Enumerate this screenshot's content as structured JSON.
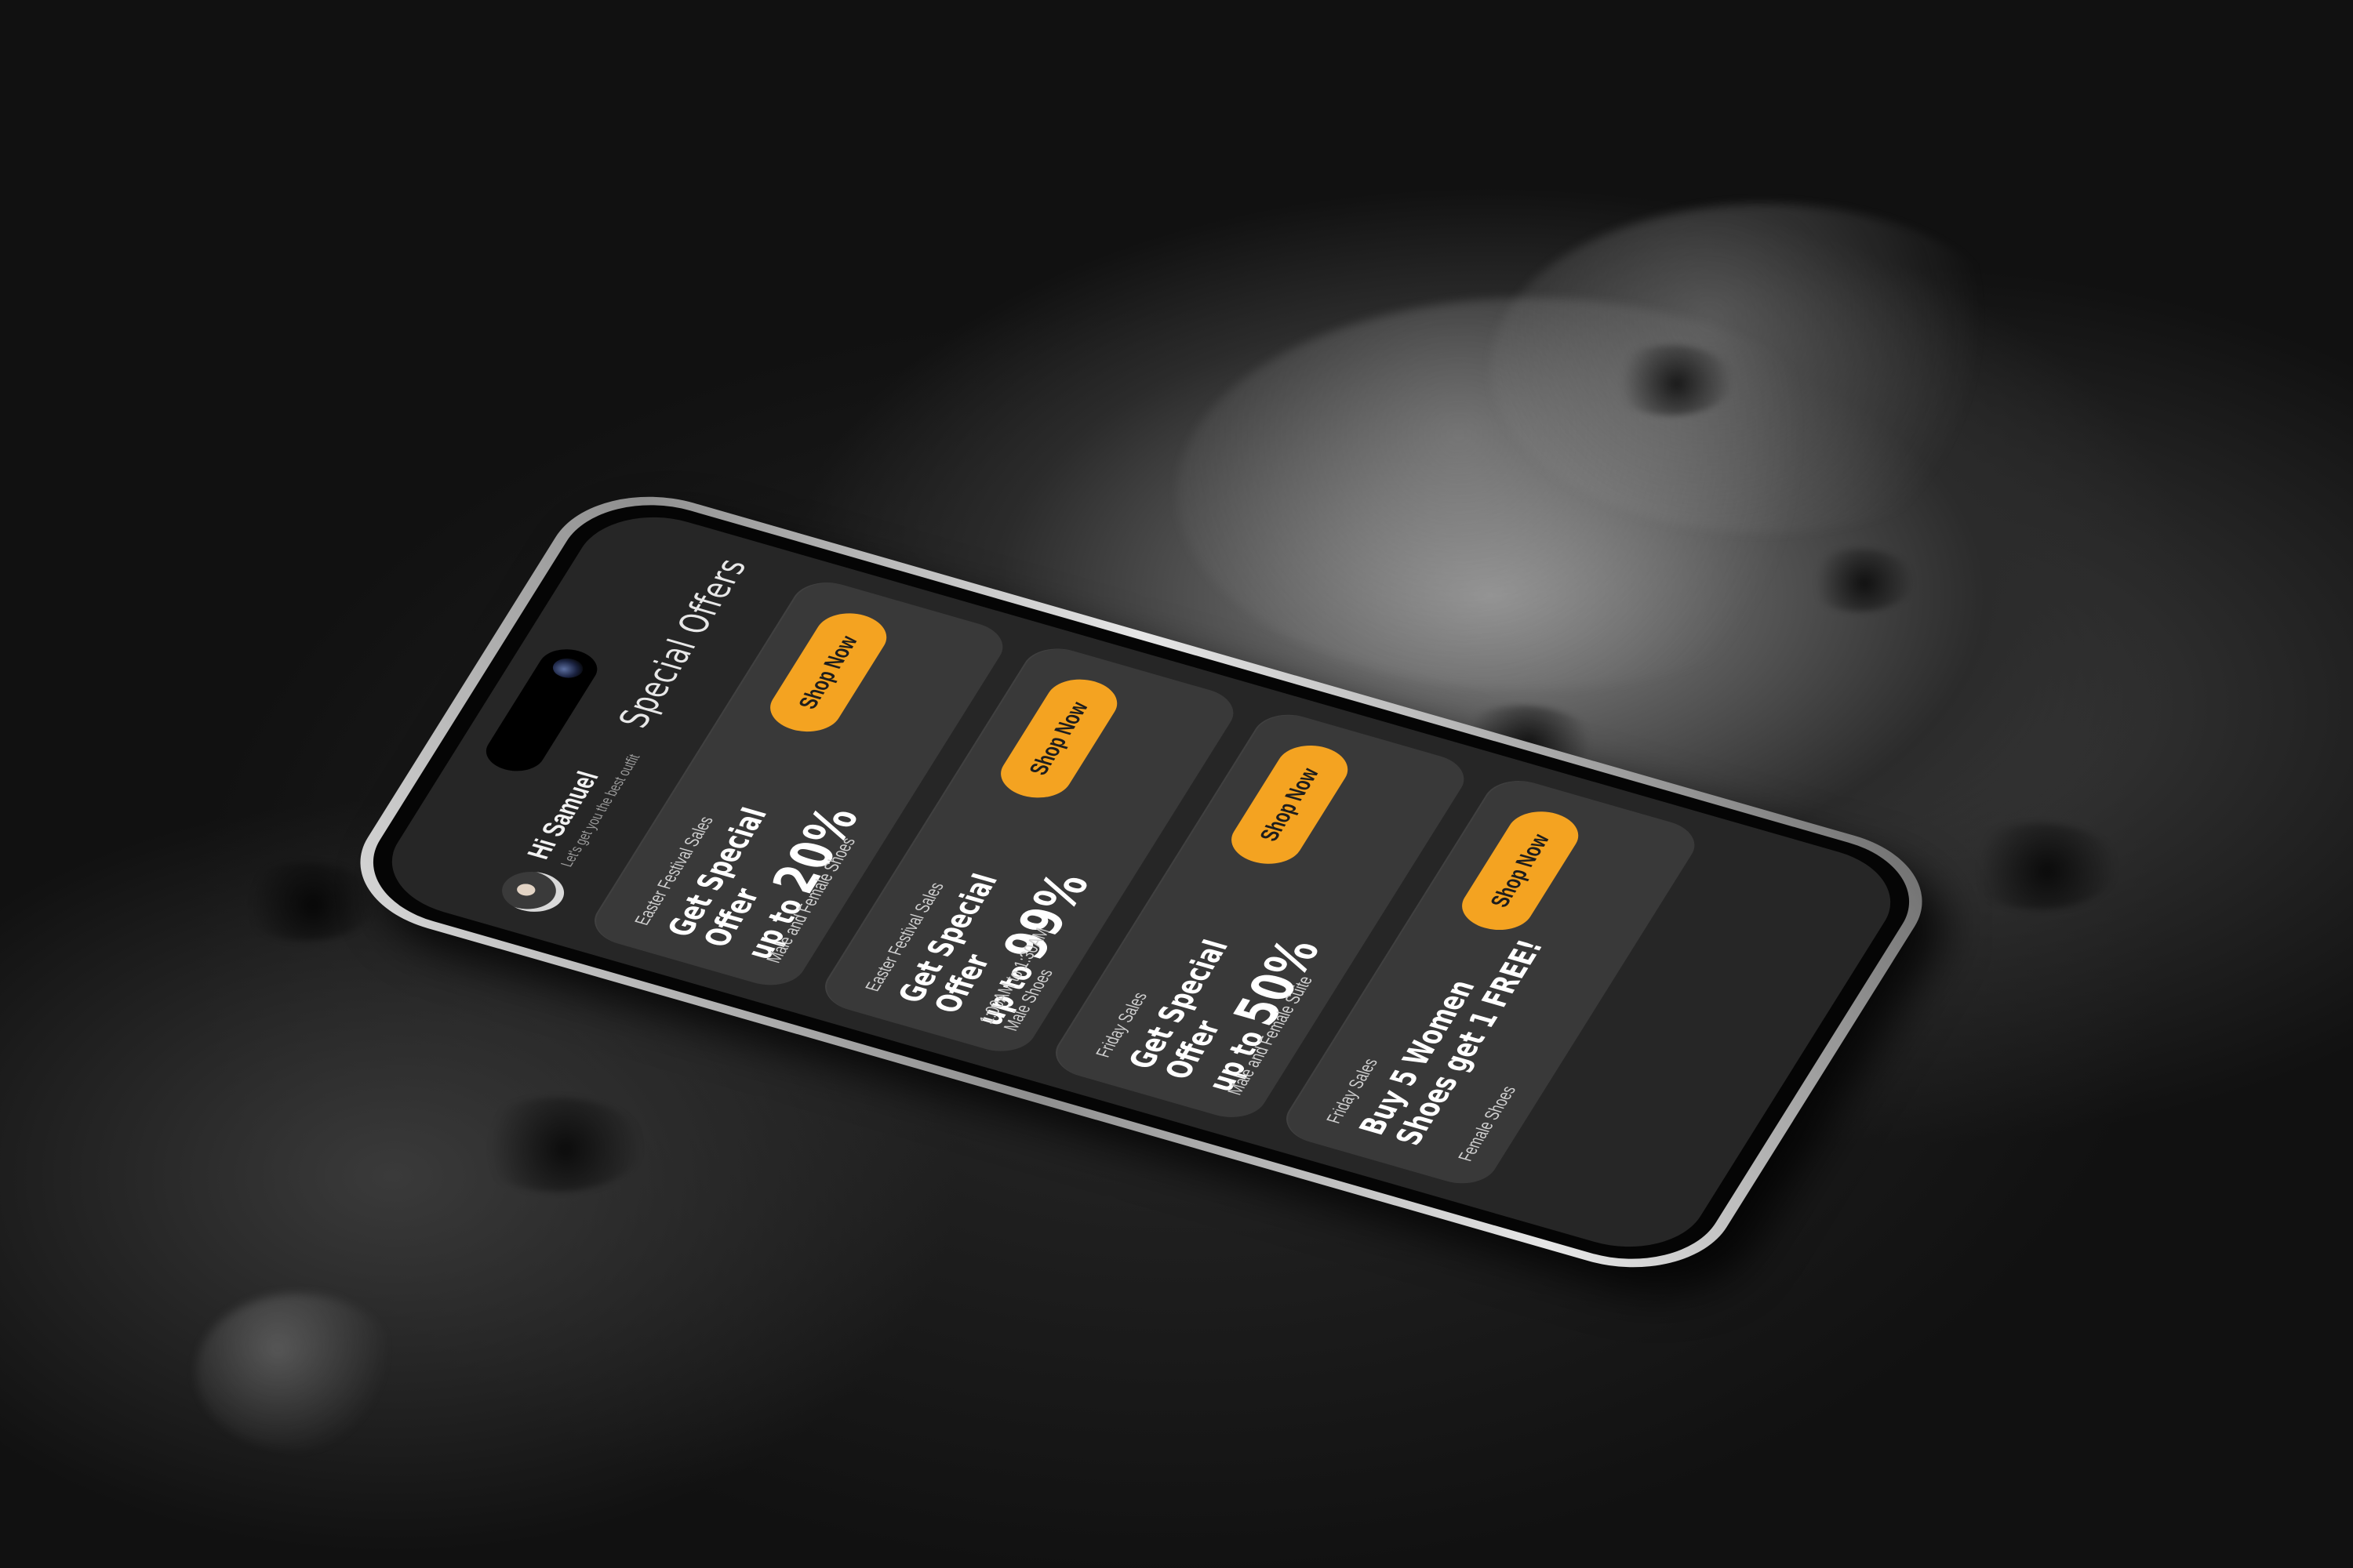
{
  "header": {
    "greeting": "Hi Samuel",
    "subgreeting": "Let's get you the best outfit",
    "title": "Special Offers"
  },
  "offers": [
    {
      "tag": "Easter Festival Sales",
      "headline": "Get Special Offer",
      "prefix": "up to",
      "amount": "20%",
      "details": [
        "Male and Female Shoes"
      ],
      "button": "Shop Now"
    },
    {
      "tag": "Easter Festival Sales",
      "headline": "Get Special Offer",
      "prefix": "up to",
      "amount": "99%",
      "details": [
        "1:00AM to 1:30AM",
        "Male  Shoes"
      ],
      "button": "Shop Now"
    },
    {
      "tag": "Friday Sales",
      "headline": "Get Special Offer",
      "prefix": "up to",
      "amount": "50%",
      "details": [
        "Male and Female Suite"
      ],
      "button": "Shop Now"
    },
    {
      "tag": "Friday Sales",
      "headline": "Buy 5 Women",
      "prefix": "Shoes get 1 FREE!",
      "amount": "",
      "details": [
        "Female Shoes"
      ],
      "button": "Shop Now"
    }
  ],
  "colors": {
    "accent": "#f4a321",
    "card": "#393939",
    "screen": "#262626"
  },
  "icons": {
    "avatar": "user-avatar",
    "camera": "front-camera-icon"
  }
}
